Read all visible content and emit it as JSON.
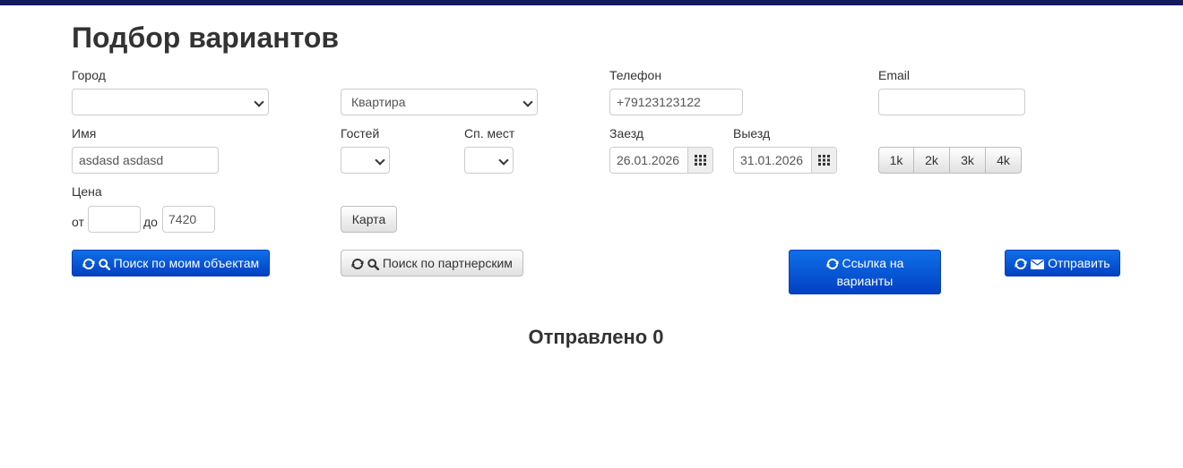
{
  "header": {
    "title": "Подбор вариантов"
  },
  "form": {
    "city": {
      "label": "Город",
      "value": ""
    },
    "type": {
      "value": "Квартира"
    },
    "phone": {
      "label": "Телефон",
      "value": "+79123123122"
    },
    "email": {
      "label": "Email",
      "value": ""
    },
    "name": {
      "label": "Имя",
      "value": "asdasd asdasd"
    },
    "guests": {
      "label": "Гостей",
      "value": ""
    },
    "beds": {
      "label": "Сп. мест",
      "value": ""
    },
    "checkin": {
      "label": "Заезд",
      "value": "26.01.2026"
    },
    "checkout": {
      "label": "Выезд",
      "value": "31.01.2026"
    },
    "rooms": [
      "1k",
      "2k",
      "3k",
      "4k"
    ],
    "price": {
      "label": "Цена",
      "from_label": "от",
      "to_label": "до",
      "from_value": "",
      "to_value": "7420"
    },
    "map_button": "Карта"
  },
  "actions": {
    "search_mine": "Поиск по моим объектам",
    "search_partners": "Поиск по партнерским",
    "link_line1": "Ссылка на",
    "link_line2": "варианты",
    "send": "Отправить"
  },
  "result": {
    "text": "Отправлено 0"
  },
  "colors": {
    "topbar": "#141a5e",
    "primary": "#0a52d6"
  }
}
